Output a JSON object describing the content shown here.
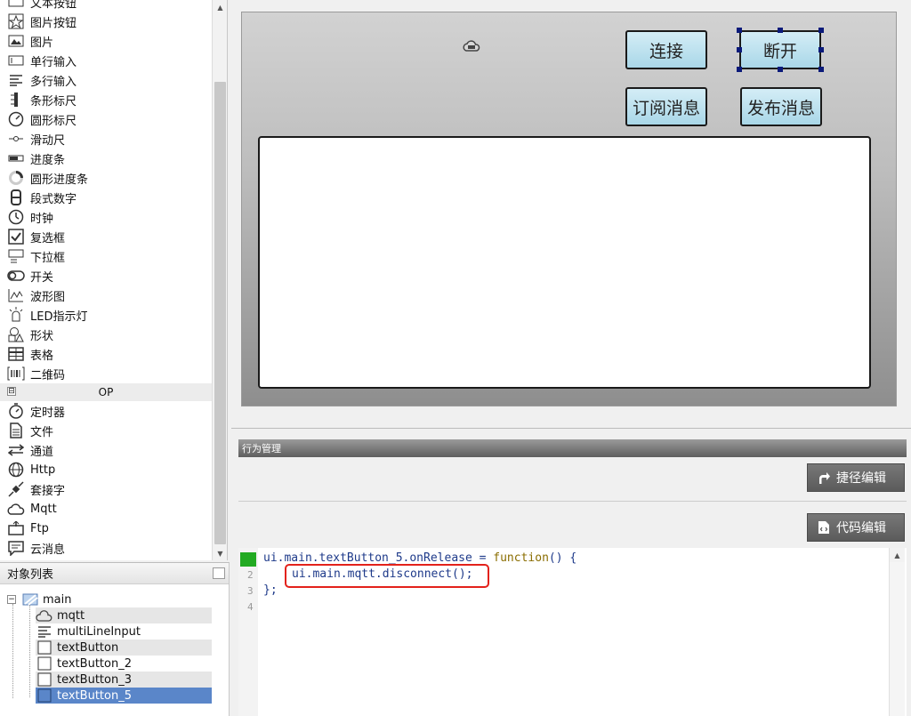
{
  "palette": {
    "items_top": [
      {
        "label": "文本按钮",
        "icon": "text-button-icon"
      },
      {
        "label": "图片按钮",
        "icon": "star-button-icon"
      },
      {
        "label": "图片",
        "icon": "image-icon"
      },
      {
        "label": "单行输入",
        "icon": "single-line-input-icon"
      },
      {
        "label": "多行输入",
        "icon": "multi-line-input-icon"
      },
      {
        "label": "条形标尺",
        "icon": "bar-ruler-icon"
      },
      {
        "label": "圆形标尺",
        "icon": "gauge-icon"
      },
      {
        "label": "滑动尺",
        "icon": "slider-icon"
      },
      {
        "label": "进度条",
        "icon": "progress-bar-icon"
      },
      {
        "label": "圆形进度条",
        "icon": "circular-progress-icon"
      },
      {
        "label": "段式数字",
        "icon": "segment-digit-icon"
      },
      {
        "label": "时钟",
        "icon": "clock-icon"
      },
      {
        "label": "复选框",
        "icon": "checkbox-icon"
      },
      {
        "label": "下拉框",
        "icon": "dropdown-icon"
      },
      {
        "label": "开关",
        "icon": "switch-icon"
      },
      {
        "label": "波形图",
        "icon": "waveform-icon"
      },
      {
        "label": "LED指示灯",
        "icon": "led-icon"
      },
      {
        "label": "形状",
        "icon": "shape-icon"
      },
      {
        "label": "表格",
        "icon": "table-icon"
      },
      {
        "label": "二维码",
        "icon": "qrcode-icon"
      }
    ],
    "category": {
      "label": "OP",
      "collapse_glyph": "⊟"
    },
    "items_op": [
      {
        "label": "定时器",
        "icon": "timer-icon"
      },
      {
        "label": "文件",
        "icon": "file-icon"
      },
      {
        "label": "通道",
        "icon": "channel-icon"
      },
      {
        "label": "Http",
        "icon": "globe-icon"
      },
      {
        "label": "套接字",
        "icon": "socket-icon"
      },
      {
        "label": "Mqtt",
        "icon": "mqtt-cloud-icon"
      },
      {
        "label": "Ftp",
        "icon": "ftp-icon"
      },
      {
        "label": "云消息",
        "icon": "cloud-message-icon"
      }
    ]
  },
  "object_list": {
    "title": "对象列表",
    "root": "main",
    "children": [
      "mqtt",
      "multiLineInput",
      "textButton",
      "textButton_2",
      "textButton_3",
      "textButton_5"
    ],
    "selected": "textButton_5"
  },
  "canvas": {
    "buttons": {
      "connect": "连接",
      "disconnect": "断开",
      "subscribe": "订阅消息",
      "publish": "发布消息"
    }
  },
  "behavior": {
    "title": "行为管理",
    "shortcut_edit": "捷径编辑",
    "code_edit": "代码编辑"
  },
  "editor": {
    "line_numbers": [
      "2",
      "3",
      "4"
    ],
    "code": {
      "line1_prefix": "ui.main.textButton_5.onRelease = ",
      "line1_kw": "function",
      "line1_suffix": "() {",
      "line2": "ui.main.mqtt.disconnect();",
      "line3": "};"
    }
  },
  "colors": {
    "selection": "#5a86c9",
    "highlight_box": "#e3221b",
    "button_fill": "#a9d7e8",
    "gutter_mark": "#22aa22"
  }
}
